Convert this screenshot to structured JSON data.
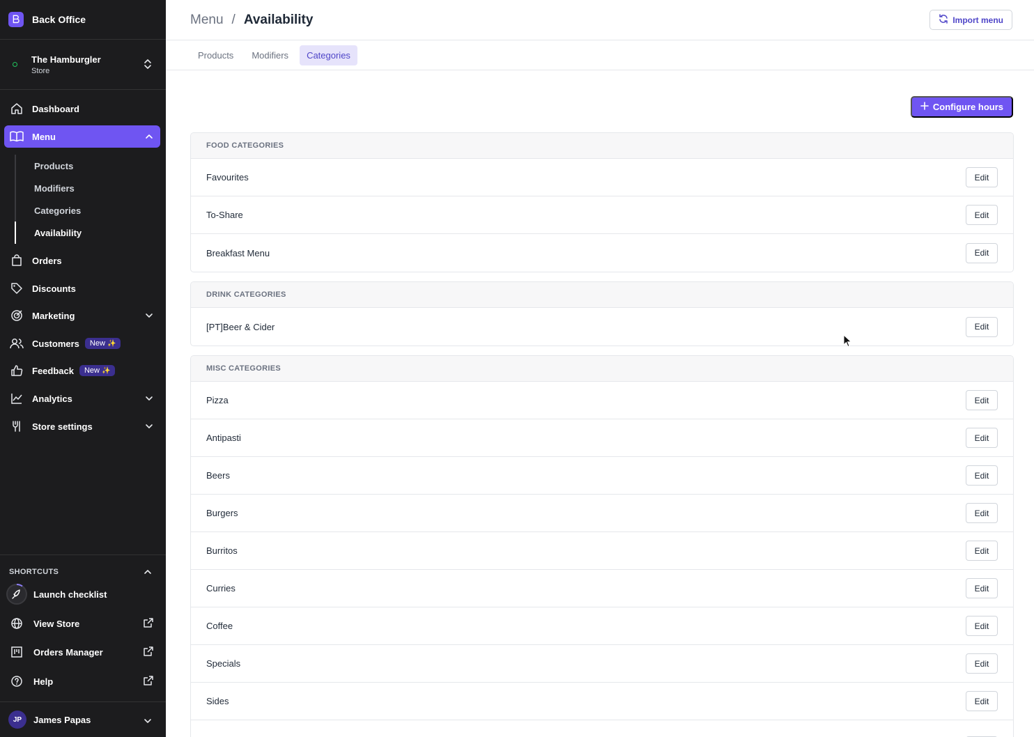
{
  "brand": {
    "title": "Back Office"
  },
  "store": {
    "name": "The Hamburgler",
    "type": "Store"
  },
  "nav": {
    "dashboard": "Dashboard",
    "menu": "Menu",
    "menu_sub": {
      "products": "Products",
      "modifiers": "Modifiers",
      "categories": "Categories",
      "availability": "Availability"
    },
    "orders": "Orders",
    "discounts": "Discounts",
    "marketing": "Marketing",
    "customers": "Customers",
    "feedback": "Feedback",
    "analytics": "Analytics",
    "store_settings": "Store settings",
    "new_badge": "New"
  },
  "shortcuts": {
    "header": "SHORTCUTS",
    "launch_checklist": "Launch checklist",
    "view_store": "View Store",
    "orders_manager": "Orders Manager",
    "help": "Help"
  },
  "user": {
    "initials": "JP",
    "name": "James Papas"
  },
  "header": {
    "crumb_parent": "Menu",
    "crumb_sep": "/",
    "crumb_current": "Availability",
    "import_label": "Import menu"
  },
  "tabs": {
    "products": "Products",
    "modifiers": "Modifiers",
    "categories": "Categories"
  },
  "configure_label": "Configure hours",
  "edit_label": "Edit",
  "groups": {
    "food": {
      "title": "FOOD CATEGORIES",
      "items": [
        "Favourites",
        "To-Share",
        "Breakfast Menu"
      ]
    },
    "drink": {
      "title": "DRINK CATEGORIES",
      "items": [
        "[PT]Beer & Cider"
      ]
    },
    "misc": {
      "title": "MISC CATEGORIES",
      "items": [
        "Pizza",
        "Antipasti",
        "Beers",
        "Burgers",
        "Burritos",
        "Curries",
        "Coffee",
        "Specials",
        "Sides"
      ]
    }
  }
}
